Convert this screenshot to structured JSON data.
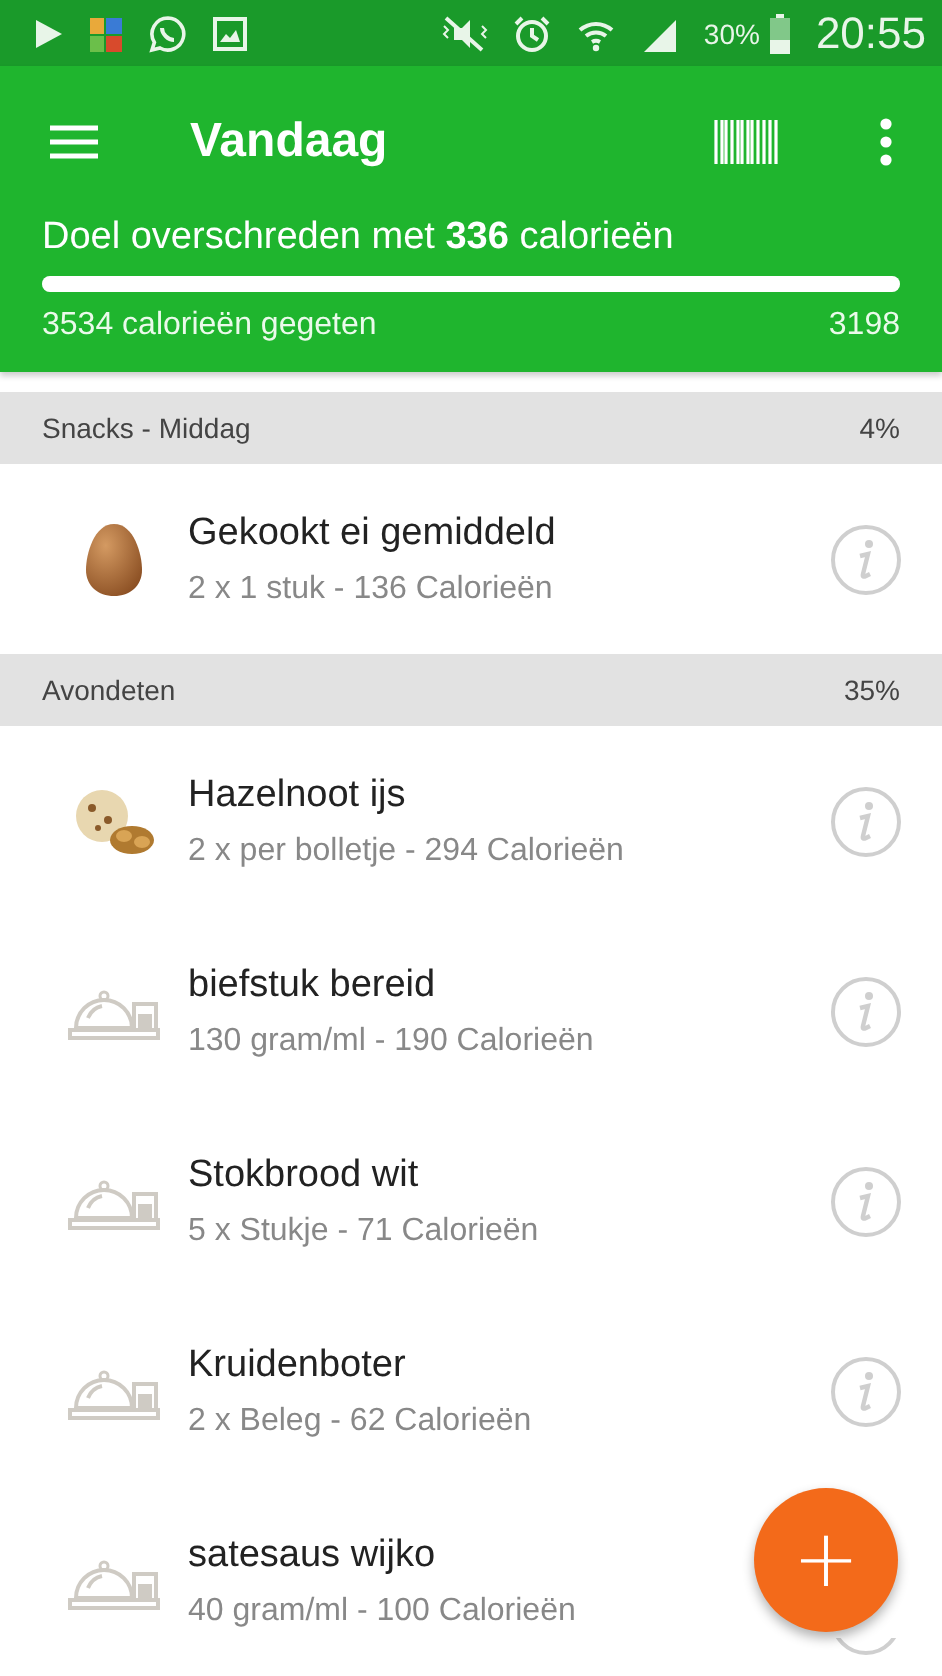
{
  "status_bar": {
    "battery": "30%",
    "time": "20:55"
  },
  "toolbar": {
    "title": "Vandaag"
  },
  "summary": {
    "message": "Doel overschreden met **336** calorieën",
    "level": 1,
    "eaten": "3534 calorieën gegeten",
    "goal": "3198"
  },
  "sections": [
    {
      "title": "Snacks - Middag",
      "percent": "4%",
      "items": [
        {
          "kind": "egg",
          "name": "Gekookt ei gemiddeld",
          "detail": "2 x 1 stuk - 136 Calorieën"
        }
      ]
    },
    {
      "title": "Avondeten",
      "percent": "35%",
      "items": [
        {
          "kind": "icecream",
          "name": "Hazelnoot ijs",
          "detail": "2 x per bolletje - 294 Calorieën"
        },
        {
          "kind": "dish",
          "name": "biefstuk bereid",
          "detail": "130 gram/ml - 190 Calorieën"
        },
        {
          "kind": "dish",
          "name": "Stokbrood wit",
          "detail": "5 x Stukje - 71 Calorieën"
        },
        {
          "kind": "dish",
          "name": "Kruidenboter",
          "detail": "2 x Beleg - 62 Calorieën"
        },
        {
          "kind": "dish",
          "name": "satesaus wijko",
          "detail": "40 gram/ml - 100 Calorieën"
        }
      ]
    }
  ],
  "fab": {
    "label": "+"
  }
}
